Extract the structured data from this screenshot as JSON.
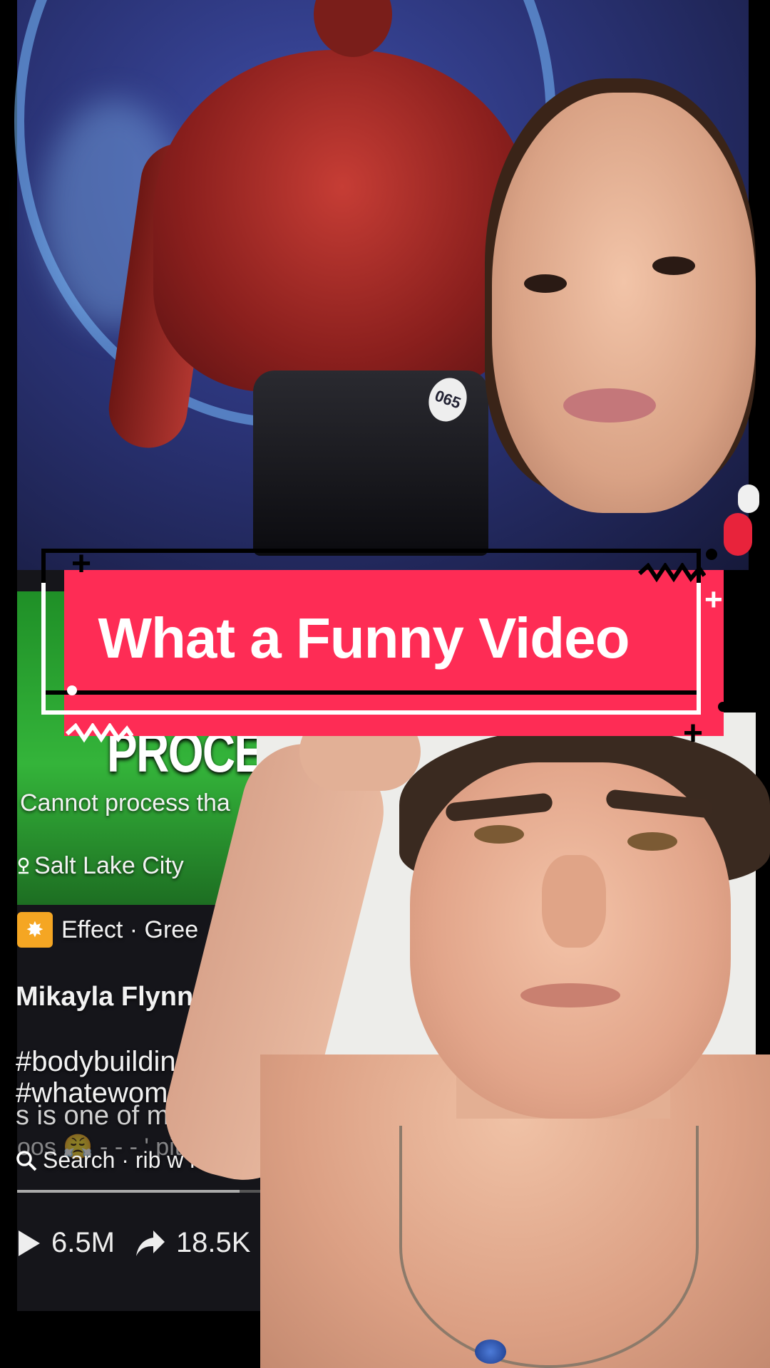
{
  "banner": {
    "title": "What a Funny Video",
    "color": "#fe2c55"
  },
  "background_video": {
    "bib_number": "065"
  },
  "embedded_tiktok": {
    "heading_fragment": "PROCES",
    "caption_fragment": "Cannot process tha",
    "location": "Salt Lake City",
    "location_icon": "location-pin-icon",
    "effect_label": "Effect · Gree",
    "effect_icon": "sparkle-effect-icon",
    "author": "Mikayla Flynn",
    "hashtags_line1": "#bodybuildin",
    "hashtags_line2": "#whatewome",
    "description": "s is one of m",
    "description_faded": "oos 😤 - - - ' pit",
    "search_text": "Search · rib w    ier bo",
    "search_icon": "search-icon",
    "progress": 0.82,
    "views": "6.5M",
    "views_icon": "play-icon",
    "shares": "18.5K",
    "shares_icon": "share-arrow-icon"
  }
}
